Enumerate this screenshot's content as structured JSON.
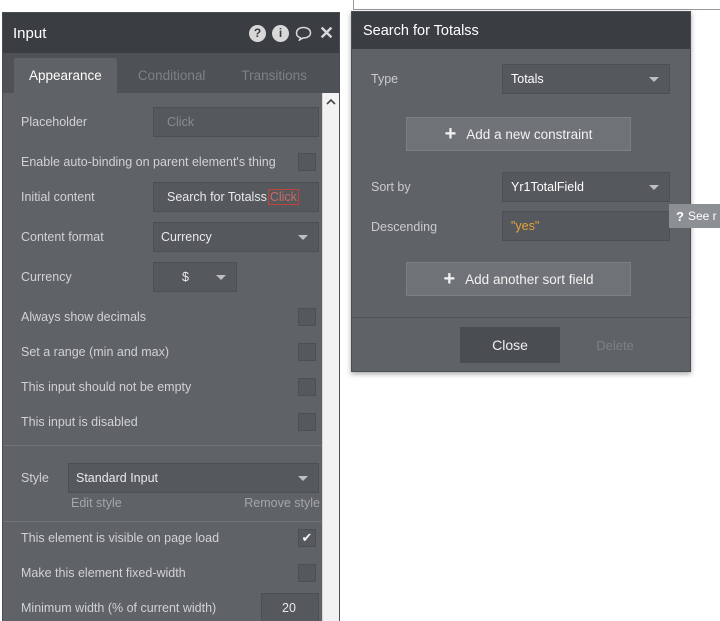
{
  "input_panel": {
    "title": "Input",
    "header_icons": [
      "help-icon",
      "info-icon",
      "comment-icon",
      "close-icon"
    ],
    "tabs": [
      {
        "label": "Appearance",
        "active": true
      },
      {
        "label": "Conditional",
        "active": false
      },
      {
        "label": "Transitions",
        "active": false
      }
    ],
    "placeholder": {
      "label": "Placeholder",
      "value": "Click"
    },
    "auto_binding": {
      "label": "Enable auto-binding on parent element's thing",
      "checked": false
    },
    "initial_content": {
      "label": "Initial content",
      "value": "Search for Totalss",
      "token": "Click"
    },
    "content_format": {
      "label": "Content format",
      "value": "Currency"
    },
    "currency": {
      "label": "Currency",
      "value": "$"
    },
    "always_show_decimals": {
      "label": "Always show decimals",
      "checked": false
    },
    "set_range": {
      "label": "Set a range (min and max)",
      "checked": false
    },
    "not_empty": {
      "label": "This input should not be empty",
      "checked": false
    },
    "disabled": {
      "label": "This input is disabled",
      "checked": false
    },
    "style": {
      "label": "Style",
      "value": "Standard Input",
      "edit_link": "Edit style",
      "remove_link": "Remove style"
    },
    "visible_on_load": {
      "label": "This element is visible on page load",
      "checked": true
    },
    "fixed_width": {
      "label": "Make this element fixed-width",
      "checked": false
    },
    "min_width": {
      "label": "Minimum width (% of current width)",
      "value": "20"
    }
  },
  "search_dialog": {
    "title": "Search for Totalss",
    "type_label": "Type",
    "type_value": "Totals",
    "add_constraint": "Add a new constraint",
    "sort_by_label": "Sort by",
    "sort_by_value": "Yr1TotalField",
    "descending_label": "Descending",
    "descending_value": "\"yes\"",
    "add_sort_field": "Add another sort field",
    "close_label": "Close",
    "delete_label": "Delete"
  },
  "tooltip": {
    "icon": "question-icon",
    "text": "See r"
  },
  "colors": {
    "panel_bg": "#5f6266",
    "header_bg": "#3a3d41",
    "value_accent": "#e3a43a",
    "token_border": "#c3423a"
  }
}
